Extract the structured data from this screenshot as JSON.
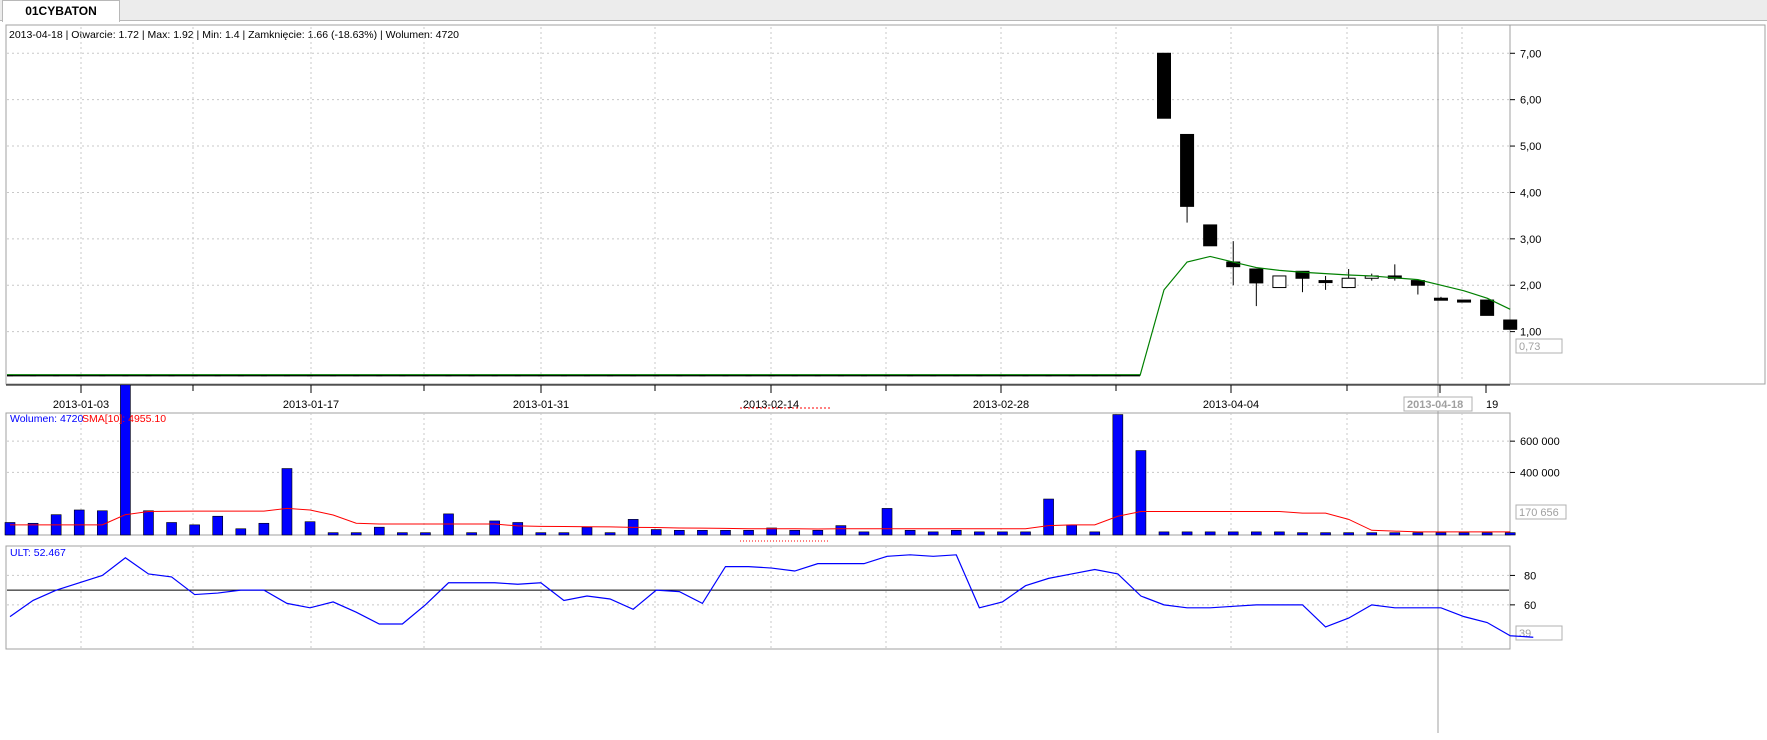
{
  "tab": {
    "label": "01CYBATON"
  },
  "info": {
    "text": "2013-04-18 | Otwarcie: 1.72 | Max: 1.92 | Min: 1.4 | Zamknięcie: 1.66 (-18.63%) | Wolumen: 4720"
  },
  "colors": {
    "volume": "#0000ff",
    "sma": "#ff0000",
    "sma_price": "#008000",
    "ult": "#0000ff",
    "grid": "#c8c8c8"
  },
  "chart_data": [
    {
      "type": "candlestick",
      "title": "01CYBATON",
      "yticks": [
        "7,00",
        "6,00",
        "5,00",
        "4,00",
        "3,00",
        "2,00",
        "1,00"
      ],
      "ylim": [
        0,
        7.2
      ],
      "x_labels": [
        "2013-01-03",
        "2013-01-17",
        "2013-01-31",
        "2013-02-14",
        "2013-02-28",
        "2013-04-04",
        "2013-04-18",
        "19"
      ],
      "last_value_label": "0,73",
      "flat_placeholder_bars": 49,
      "candles": [
        {
          "o": 7.0,
          "h": 7.0,
          "l": 5.6,
          "c": 5.6
        },
        {
          "o": 5.25,
          "h": 5.25,
          "l": 3.35,
          "c": 3.7
        },
        {
          "o": 3.3,
          "h": 3.3,
          "l": 2.85,
          "c": 2.85
        },
        {
          "o": 2.5,
          "h": 2.95,
          "l": 2.0,
          "c": 2.4
        },
        {
          "o": 2.35,
          "h": 2.35,
          "l": 1.55,
          "c": 2.05
        },
        {
          "o": 1.95,
          "h": 2.2,
          "l": 1.95,
          "c": 2.2
        },
        {
          "o": 2.3,
          "h": 2.3,
          "l": 1.85,
          "c": 2.15
        },
        {
          "o": 2.1,
          "h": 2.2,
          "l": 1.9,
          "c": 2.1
        },
        {
          "o": 1.95,
          "h": 2.35,
          "l": 1.95,
          "c": 2.15
        },
        {
          "o": 2.15,
          "h": 2.25,
          "l": 2.1,
          "c": 2.2
        },
        {
          "o": 2.2,
          "h": 2.45,
          "l": 2.1,
          "c": 2.15
        },
        {
          "o": 2.1,
          "h": 2.1,
          "l": 1.8,
          "c": 2.0
        },
        {
          "o": 1.72,
          "h": 1.75,
          "l": 1.68,
          "c": 1.68
        },
        {
          "o": 1.68,
          "h": 1.68,
          "l": 1.65,
          "c": 1.66
        },
        {
          "o": 1.68,
          "h": 1.68,
          "l": 1.35,
          "c": 1.35
        },
        {
          "o": 1.25,
          "h": 1.25,
          "l": 1.05,
          "c": 1.05
        }
      ],
      "sma_price": [
        1.9,
        2.5,
        2.62,
        2.5,
        2.38,
        2.32,
        2.28,
        2.25,
        2.22,
        2.2,
        2.16,
        2.12,
        2.0,
        1.88,
        1.72,
        1.48
      ],
      "sma_price_base": 0.05
    },
    {
      "type": "bar",
      "title": "Wolumen",
      "legend": {
        "volume": "Wolumen: 4720",
        "sma": "SMA[10]: 4955.10"
      },
      "yticks": [
        "600 000",
        "400 000"
      ],
      "ylim": [
        0,
        780000
      ],
      "last_value_label": "170 656",
      "values": [
        80000,
        75000,
        130000,
        160000,
        155000,
        960000,
        155000,
        80000,
        65000,
        120000,
        40000,
        75000,
        425000,
        85000,
        15000,
        15000,
        50000,
        15000,
        15000,
        135000,
        15000,
        90000,
        80000,
        15000,
        15000,
        50000,
        15000,
        100000,
        35000,
        30000,
        30000,
        30000,
        30000,
        45000,
        30000,
        30000,
        60000,
        20000,
        170000,
        30000,
        20000,
        30000,
        20000,
        20000,
        20000,
        230000,
        65000,
        20000,
        770000,
        540000,
        20000,
        20000,
        20000,
        20000,
        20000,
        20000,
        15000,
        15000,
        15000,
        15000,
        15000,
        15000,
        15000,
        15000,
        15000,
        15000
      ],
      "sma": [
        65000,
        65000,
        65000,
        65000,
        65000,
        130000,
        150000,
        152000,
        153000,
        153000,
        153000,
        153000,
        170000,
        160000,
        128000,
        75000,
        70000,
        70000,
        70000,
        70000,
        70000,
        70000,
        58000,
        55000,
        54000,
        53000,
        52000,
        49000,
        48000,
        45000,
        44000,
        42000,
        40000,
        40000,
        40000,
        38000,
        40000,
        40000,
        40000,
        40000,
        40000,
        40000,
        40000,
        40000,
        40000,
        60000,
        65000,
        65000,
        120000,
        150000,
        150000,
        150000,
        150000,
        150000,
        150000,
        150000,
        140000,
        140000,
        100000,
        30000,
        25000,
        20000,
        20000,
        20000,
        20000,
        20000
      ]
    },
    {
      "type": "line",
      "title": "ULT",
      "legend": "ULT: 52.467",
      "yticks": [
        "80",
        "60"
      ],
      "ylim": [
        30,
        100
      ],
      "reference_level": 70,
      "last_value_label": "39",
      "values": [
        52,
        63,
        70,
        75,
        80,
        92,
        81,
        79,
        67,
        68,
        70,
        70,
        61,
        58,
        62,
        55,
        47,
        47,
        60,
        75,
        75,
        75,
        74,
        75,
        63,
        66,
        64,
        57,
        70,
        69,
        61,
        86,
        86,
        85,
        83,
        88,
        88,
        88,
        93,
        94,
        93,
        94,
        58,
        62,
        73,
        78,
        81,
        84,
        81,
        66,
        60,
        58,
        58,
        59,
        60,
        60,
        60,
        45,
        51,
        60,
        58,
        58,
        58,
        52,
        48,
        39,
        38
      ]
    }
  ]
}
